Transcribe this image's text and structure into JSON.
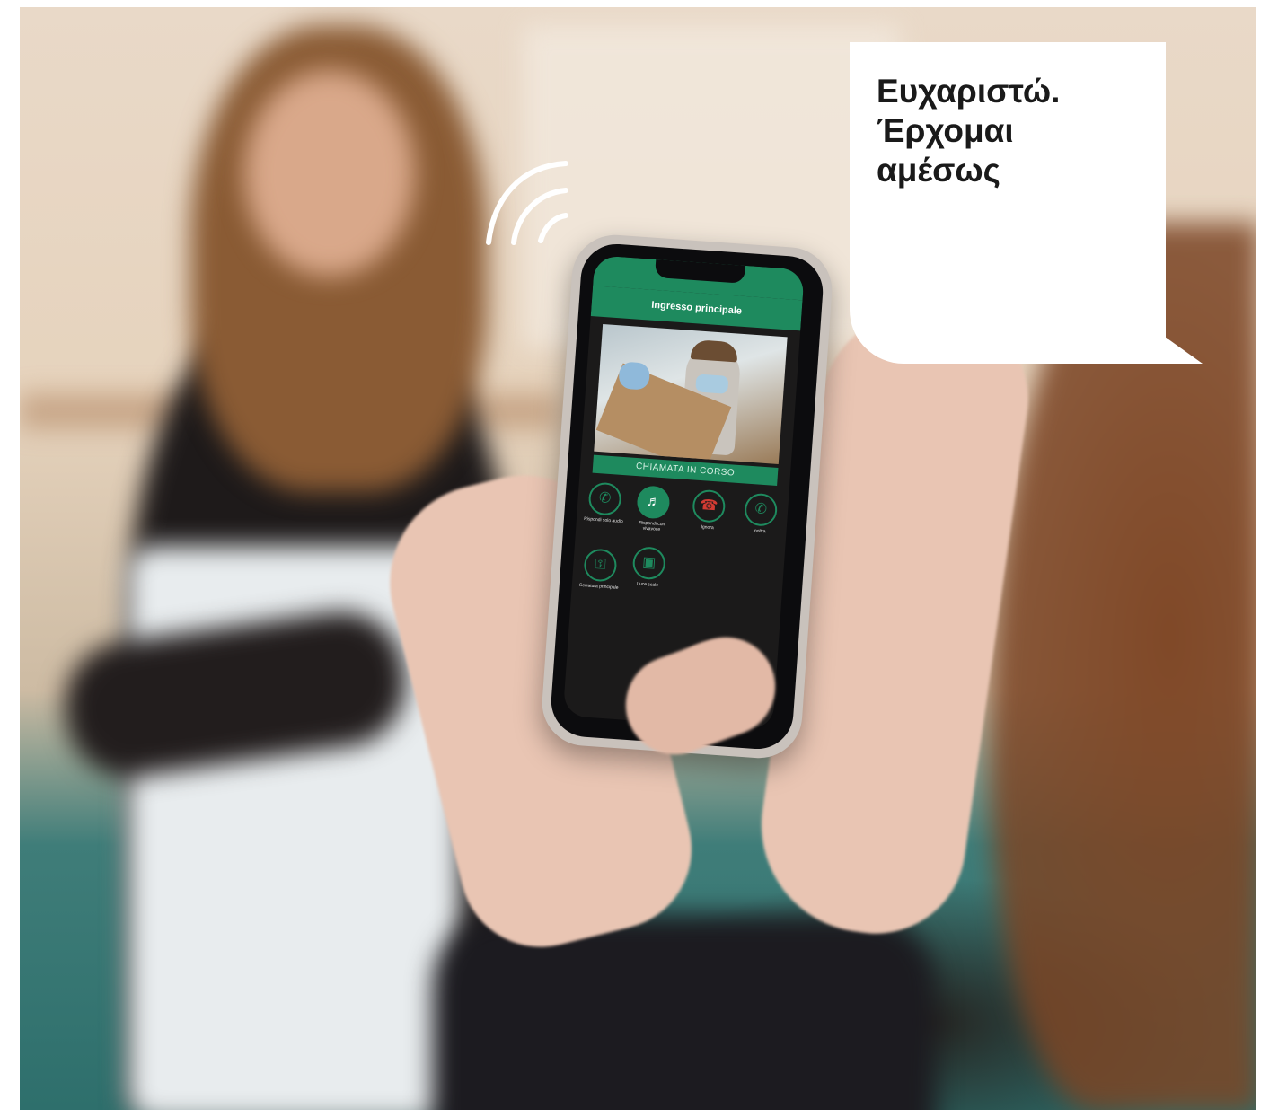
{
  "speech_bubble": {
    "lines": [
      "Ευχαριστώ.",
      "Έρχομαι",
      "αμέσως"
    ]
  },
  "phone_app": {
    "header_title": "Ingresso principale",
    "call_status": "CHIAMATA IN CORSO",
    "buttons": [
      {
        "label": "Rispondi solo audio",
        "icon": "phone-icon"
      },
      {
        "label": "Rispondi con vivavoce",
        "icon": "speaker-icon"
      },
      {
        "label": "Ignora",
        "icon": "hangup-icon"
      },
      {
        "label": "Inoltra",
        "icon": "forward-call-icon"
      },
      {
        "label": "Serratura principale",
        "icon": "key-icon"
      },
      {
        "label": "Luce scale",
        "icon": "light-switch-icon"
      }
    ]
  },
  "colors": {
    "accent_green": "#1e8a5e",
    "reject_red": "#d23b33",
    "bubble_white": "#ffffff"
  }
}
